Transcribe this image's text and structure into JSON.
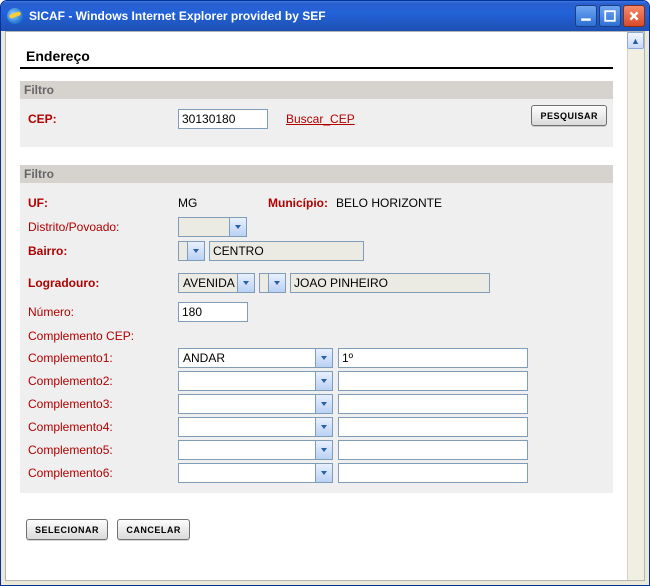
{
  "window": {
    "title": "SICAF - Windows Internet Explorer provided by SEF"
  },
  "page": {
    "title": "Endereço"
  },
  "filtro1": {
    "heading": "Filtro",
    "cep_label": "CEP:",
    "cep_value": "30130180",
    "buscar_cep": "Buscar_CEP",
    "pesquisar": "PESQUISAR"
  },
  "filtro2": {
    "heading": "Filtro",
    "uf_label": "UF:",
    "uf_value": "MG",
    "municipio_label": "Município:",
    "municipio_value": "BELO HORIZONTE",
    "distrito_label": "Distrito/Povoado:",
    "distrito_value": "",
    "bairro_label": "Bairro:",
    "bairro_tipo": "",
    "bairro_value": "CENTRO",
    "logradouro_label": "Logradouro:",
    "logradouro_tipo": "AVENIDA",
    "logradouro_mid": "",
    "logradouro_value": "JOAO PINHEIRO",
    "numero_label": "Número:",
    "numero_value": "180",
    "comp_cep_label": "Complemento CEP:",
    "comp1_label": "Complemento1:",
    "comp1_sel": "ANDAR",
    "comp1_val": "1º",
    "comp2_label": "Complemento2:",
    "comp2_sel": "",
    "comp2_val": "",
    "comp3_label": "Complemento3:",
    "comp3_sel": "",
    "comp3_val": "",
    "comp4_label": "Complemento4:",
    "comp4_sel": "",
    "comp4_val": "",
    "comp5_label": "Complemento5:",
    "comp5_sel": "",
    "comp5_val": "",
    "comp6_label": "Complemento6:",
    "comp6_sel": "",
    "comp6_val": ""
  },
  "actions": {
    "selecionar": "SELECIONAR",
    "cancelar": "CANCELAR"
  }
}
